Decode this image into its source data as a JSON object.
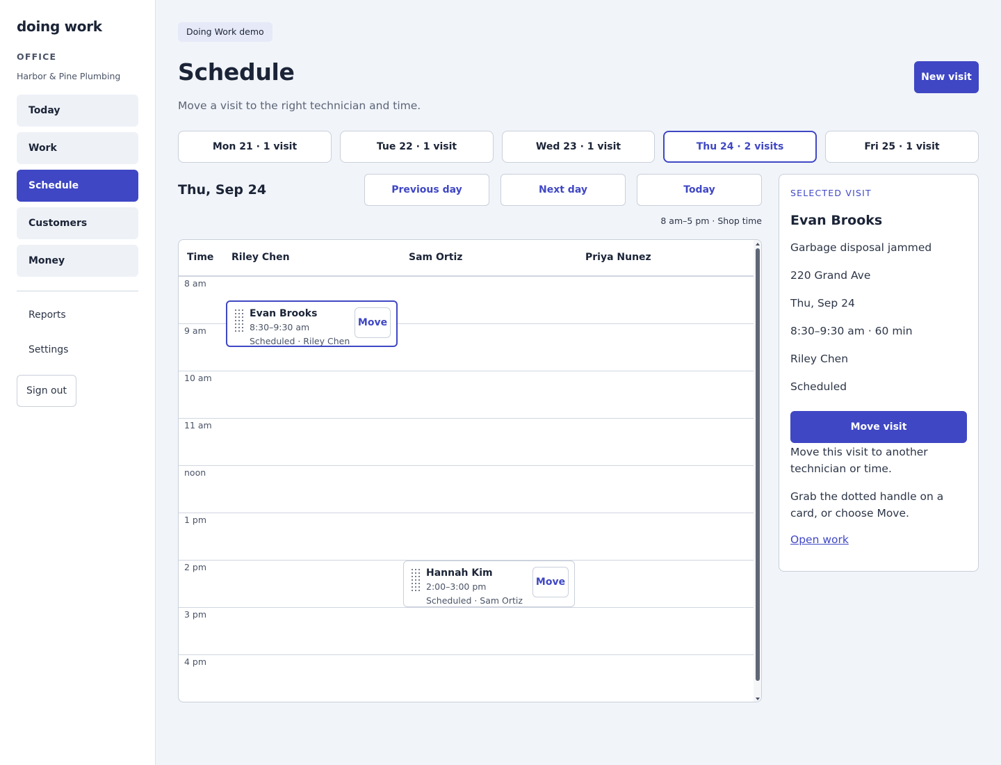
{
  "sidebar": {
    "brand": "doing work",
    "office_label": "OFFICE",
    "office_name": "Harbor & Pine Plumbing",
    "nav": [
      {
        "label": "Today",
        "active": false
      },
      {
        "label": "Work",
        "active": false
      },
      {
        "label": "Schedule",
        "active": true
      },
      {
        "label": "Customers",
        "active": false
      },
      {
        "label": "Money",
        "active": false
      }
    ],
    "secondary": [
      {
        "label": "Reports"
      },
      {
        "label": "Settings"
      }
    ],
    "sign_out": "Sign out"
  },
  "header": {
    "badge": "Doing Work demo",
    "title": "Schedule",
    "subtitle": "Move a visit to the right technician and time.",
    "new_visit": "New visit"
  },
  "day_tabs": [
    {
      "label": "Mon 21 · 1 visit",
      "active": false
    },
    {
      "label": "Tue 22 · 1 visit",
      "active": false
    },
    {
      "label": "Wed 23 · 1 visit",
      "active": false
    },
    {
      "label": "Thu 24 · 2 visits",
      "active": true
    },
    {
      "label": "Fri 25 · 1 visit",
      "active": false
    }
  ],
  "day": {
    "heading": "Thu, Sep 24",
    "previous": "Previous day",
    "next": "Next day",
    "today": "Today",
    "hours_note": "8 am–5 pm · Shop time"
  },
  "grid": {
    "time_header": "Time",
    "technicians": [
      "Riley Chen",
      "Sam Ortiz",
      "Priya Nunez"
    ],
    "hours": [
      "8 am",
      "9 am",
      "10 am",
      "11 am",
      "noon",
      "1 pm",
      "2 pm",
      "3 pm",
      "4 pm"
    ],
    "visits": [
      {
        "name": "Evan Brooks",
        "time": "8:30–9:30 am",
        "status": "Scheduled · Riley Chen",
        "move": "Move",
        "selected": true
      },
      {
        "name": "Hannah Kim",
        "time": "2:00–3:00 pm",
        "status": "Scheduled · Sam Ortiz",
        "move": "Move",
        "selected": false
      }
    ]
  },
  "panel": {
    "label": "SELECTED VISIT",
    "name": "Evan Brooks",
    "problem": "Garbage disposal jammed",
    "address": "220 Grand Ave",
    "date": "Thu, Sep 24",
    "time": "8:30–9:30 am · 60 min",
    "technician": "Riley Chen",
    "status": "Scheduled",
    "move_button": "Move visit",
    "move_hint": "Move this visit to another technician or time.",
    "drag_hint": "Grab the dotted handle on a card, or choose Move.",
    "open_link": "Open work"
  },
  "colors": {
    "accent": "#3f47c4",
    "background": "#f1f4f9",
    "text": "#1b2437"
  }
}
